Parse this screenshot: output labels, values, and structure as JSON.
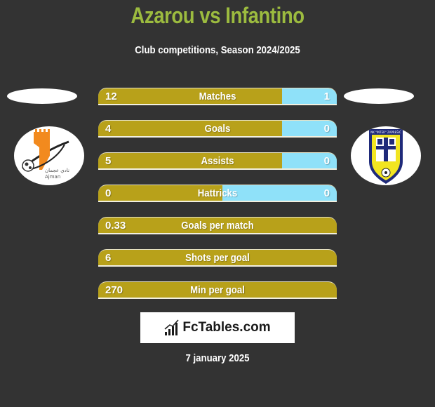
{
  "header": {
    "title": "Azarou vs Infantino",
    "subtitle": "Club competitions, Season 2024/2025"
  },
  "colors": {
    "background": "#333333",
    "title": "#9cbb3f",
    "left_bar": "#b8a11a",
    "right_bar": "#8fe1f9"
  },
  "players": {
    "left": {
      "name": "Azarou",
      "club_logo": "ajman-club-logo",
      "logo_text": "Ajman"
    },
    "right": {
      "name": "Infantino",
      "club_logo": "nk-inter-zapresic-logo",
      "logo_text": "NK \"INTER\" ZAPREŠIĆ"
    }
  },
  "stats": [
    {
      "label": "Matches",
      "left": "12",
      "right": "1",
      "right_share": 0.23
    },
    {
      "label": "Goals",
      "left": "4",
      "right": "0",
      "right_share": 0.23
    },
    {
      "label": "Assists",
      "left": "5",
      "right": "0",
      "right_share": 0.23
    },
    {
      "label": "Hattricks",
      "left": "0",
      "right": "0",
      "right_share": 0.48
    },
    {
      "label": "Goals per match",
      "left": "0.33",
      "right": null,
      "right_share": 0
    },
    {
      "label": "Shots per goal",
      "left": "6",
      "right": null,
      "right_share": 0
    },
    {
      "label": "Min per goal",
      "left": "270",
      "right": null,
      "right_share": 0
    }
  ],
  "footer": {
    "brand": "FcTables.com",
    "brand_icon": "bar-chart-icon",
    "date": "7 january 2025"
  }
}
